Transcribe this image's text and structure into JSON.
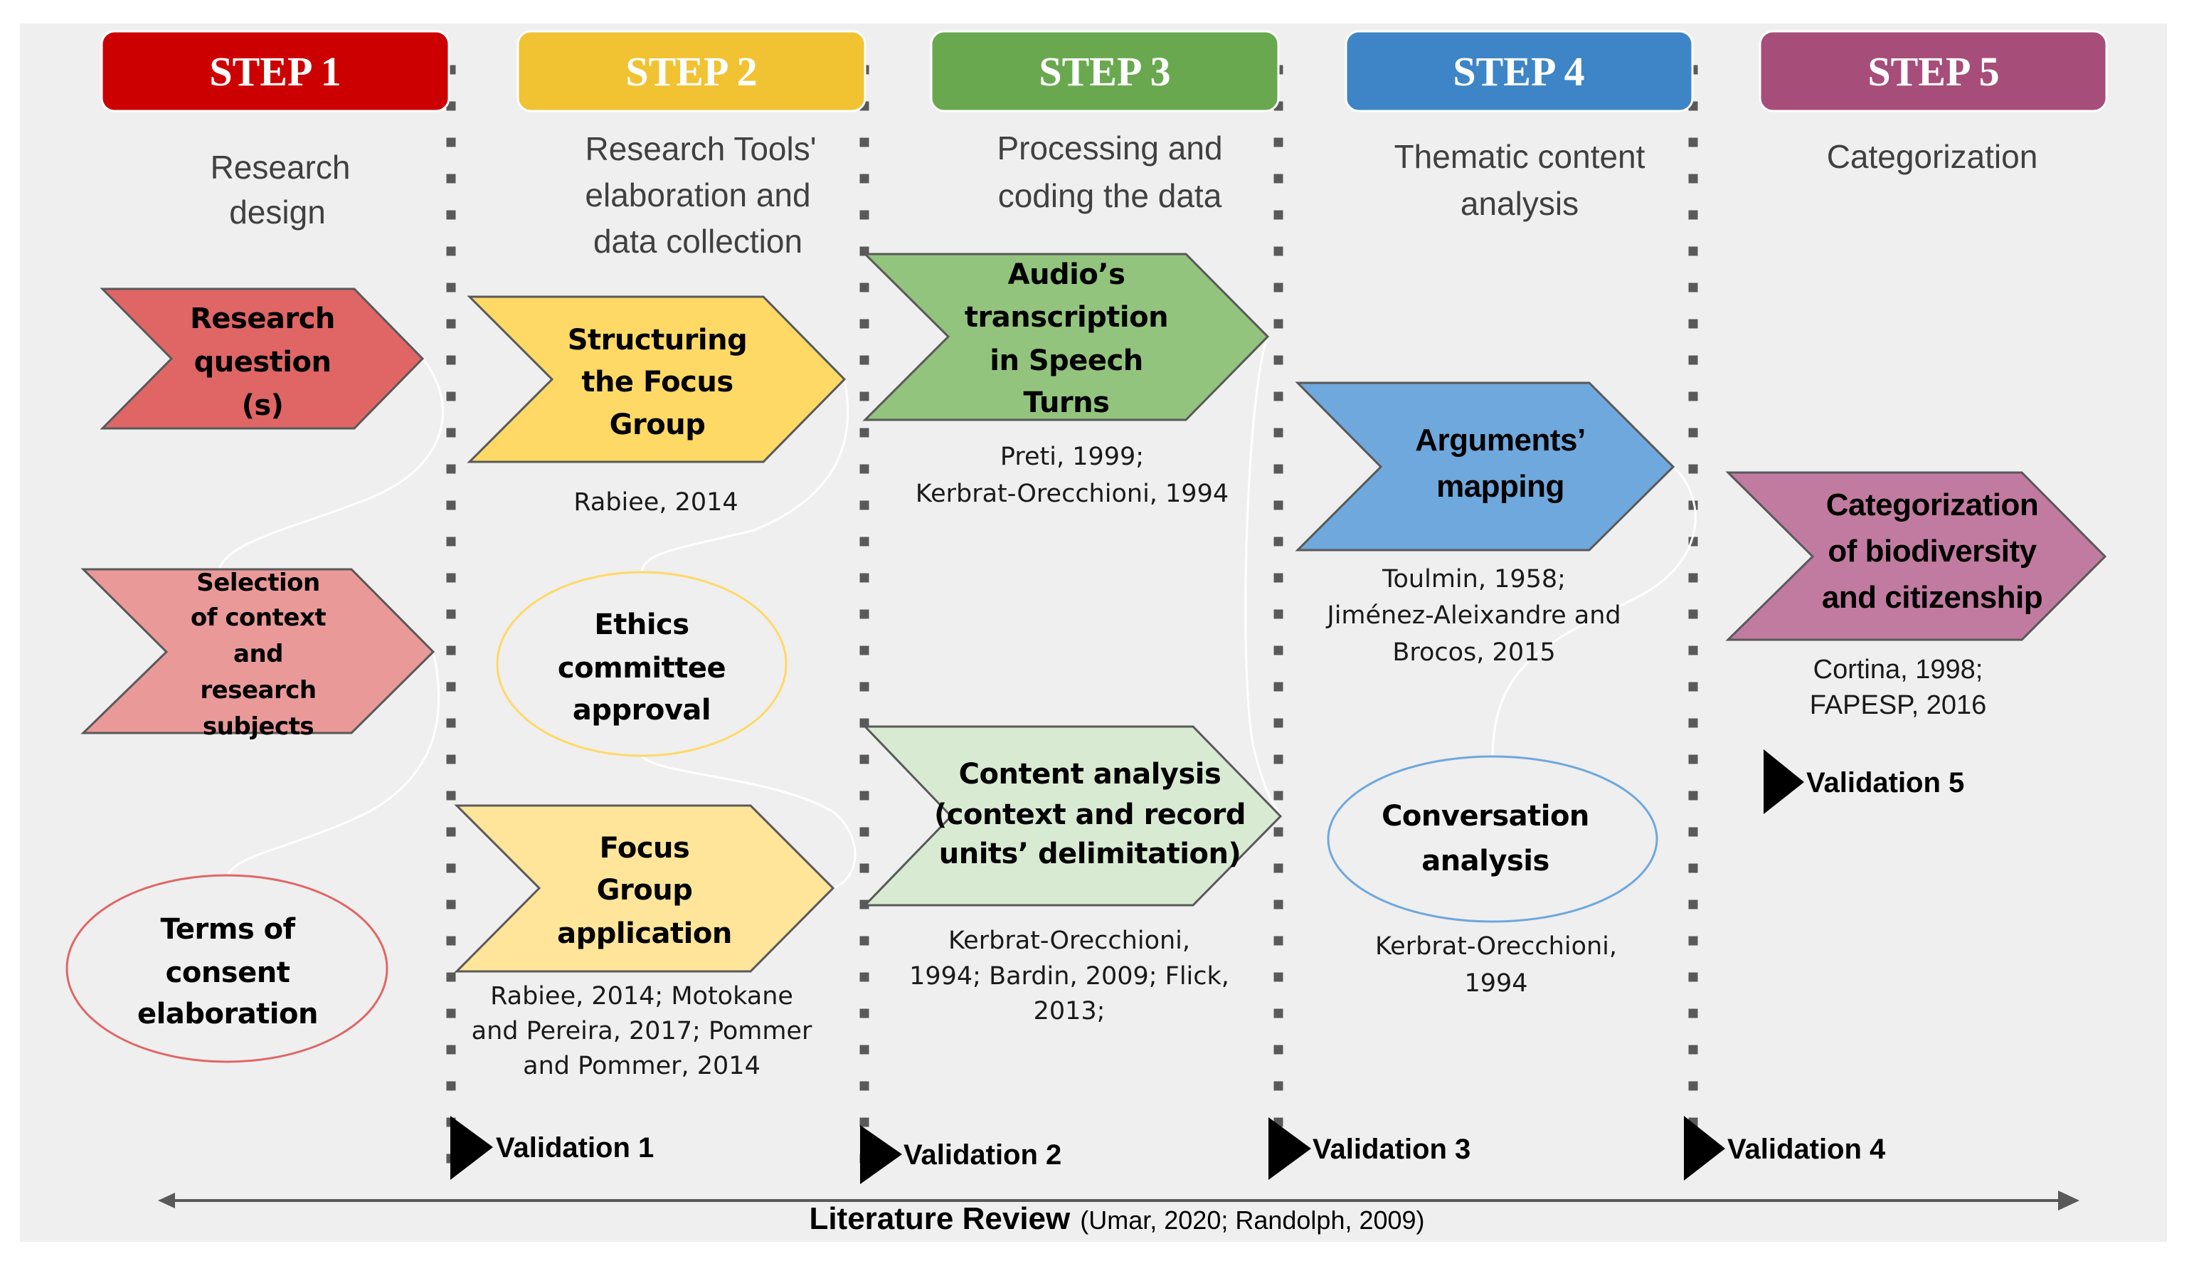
{
  "colors": {
    "panel_bg": "#efefef",
    "divider": "#595959",
    "chevron_stroke": "#595959",
    "connector": "#ffffff",
    "subtitle_text": "#404040"
  },
  "steps": [
    {
      "label": "STEP 1",
      "color": "#cc0000",
      "subtitle": [
        "Research",
        "design"
      ]
    },
    {
      "label": "STEP 2",
      "color": "#f1c232",
      "subtitle": [
        "Research Tools'",
        "elaboration and",
        "data collection"
      ]
    },
    {
      "label": "STEP 3",
      "color": "#6aa84f",
      "subtitle": [
        "Processing and",
        "coding the data"
      ]
    },
    {
      "label": "STEP 4",
      "color": "#3d85c6",
      "subtitle": [
        "Thematic content",
        "analysis"
      ]
    },
    {
      "label": "STEP 5",
      "color": "#a64d79",
      "subtitle": [
        "Categorization"
      ]
    }
  ],
  "nodes": {
    "research_question": {
      "shape": "chevron",
      "fill": "#e06666",
      "lines": [
        "Research",
        "question",
        "(s)"
      ]
    },
    "selection_context": {
      "shape": "chevron",
      "fill": "#ea9999",
      "lines": [
        "Selection",
        "of context",
        "and",
        "research",
        "subjects"
      ]
    },
    "terms_consent": {
      "shape": "ellipse",
      "stroke": "#e06666",
      "lines": [
        "Terms of",
        "consent",
        "elaboration"
      ]
    },
    "structuring_focus_group": {
      "shape": "chevron",
      "fill": "#ffd966",
      "lines": [
        "Structuring",
        "the Focus",
        "Group"
      ],
      "refs": [
        "Rabiee, 2014"
      ]
    },
    "ethics_committee": {
      "shape": "ellipse",
      "stroke": "#ffd966",
      "lines": [
        "Ethics",
        "committee",
        "approval"
      ]
    },
    "focus_group_application": {
      "shape": "chevron",
      "fill": "#ffe599",
      "lines": [
        "Focus",
        "Group",
        "application"
      ],
      "refs": [
        "Rabiee, 2014; Motokane",
        "and Pereira, 2017; Pommer",
        "and Pommer, 2014"
      ]
    },
    "audio_transcription": {
      "shape": "chevron",
      "fill": "#93c47d",
      "lines": [
        "Audio’s",
        "transcription",
        "in Speech",
        "Turns"
      ],
      "refs": [
        "Preti, 1999;",
        "Kerbrat-Orecchioni, 1994"
      ]
    },
    "content_analysis": {
      "shape": "chevron",
      "fill": "#d9ead3",
      "lines": [
        "Content analysis",
        "(context and record",
        "units’ delimitation)"
      ],
      "refs": [
        "Kerbrat-Orecchioni,",
        "1994; Bardin, 2009; Flick,",
        "2013;"
      ]
    },
    "arguments_mapping": {
      "shape": "chevron",
      "fill": "#6fa8dc",
      "lines": [
        "Arguments’",
        "mapping"
      ],
      "refs": [
        "Toulmin, 1958;",
        "Jiménez-Aleixandre and",
        "Brocos, 2015"
      ]
    },
    "conversation_analysis": {
      "shape": "ellipse",
      "stroke": "#6fa8dc",
      "lines": [
        "Conversation",
        "analysis"
      ],
      "refs": [
        "Kerbrat-Orecchioni,",
        "1994"
      ]
    },
    "categorization": {
      "shape": "chevron",
      "fill": "#c27ba0",
      "lines": [
        "Categorization",
        "of biodiversity",
        "and citizenship"
      ],
      "refs": [
        "Cortina, 1998;",
        "FAPESP, 2016"
      ]
    }
  },
  "validations": [
    "Validation 1",
    "Validation 2",
    "Validation 3",
    "Validation 4",
    "Validation 5"
  ],
  "literature_review": {
    "label": "Literature Review",
    "citation": "(Umar, 2020; Randolph, 2009)"
  }
}
